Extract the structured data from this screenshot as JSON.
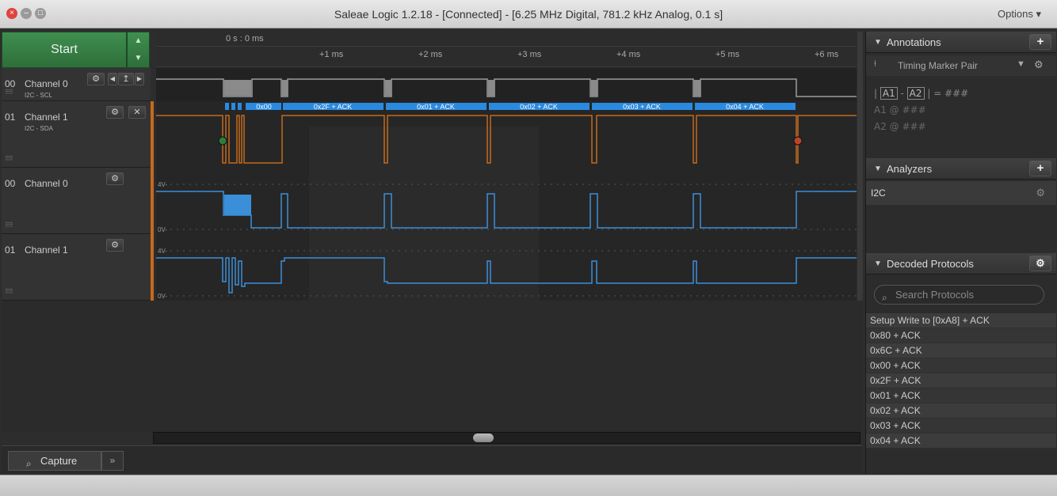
{
  "window": {
    "title": "Saleae Logic 1.2.18 - [Connected] - [6.25 MHz Digital, 781.2 kHz Analog, 0.1 s]",
    "options_label": "Options ▾"
  },
  "toolbar": {
    "start_label": "Start"
  },
  "ruler": {
    "zero_label": "0 s : 0 ms",
    "ticks": [
      "+1 ms",
      "+2 ms",
      "+3 ms",
      "+4 ms",
      "+5 ms",
      "+6 ms"
    ]
  },
  "channels": [
    {
      "num": "00",
      "name": "Channel 0",
      "sub": "I2C - SCL"
    },
    {
      "num": "01",
      "name": "Channel 1",
      "sub": "I2C - SDA"
    },
    {
      "num": "00",
      "name": "Channel 0"
    },
    {
      "num": "01",
      "name": "Channel 1"
    }
  ],
  "bus_labels": [
    "0x00",
    "0x2F + ACK",
    "0x01 + ACK",
    "0x02 + ACK",
    "0x03 + ACK",
    "0x04 + ACK"
  ],
  "analog_axis": {
    "high": "4V-",
    "low": "0V-"
  },
  "colors": {
    "digital_scl": "#9c9c9c",
    "digital_sda": "#c46a1c",
    "analog": "#3b8fd9",
    "bus": "#2a8ae0",
    "start_green": "#3f8f4f"
  },
  "bottom": {
    "capture_label": "Capture",
    "more_label": "»"
  },
  "annotations": {
    "header": "Annotations",
    "timing_marker": "Timing Marker Pair",
    "line_a": "A1",
    "line_b": "A2",
    "eq": "= ###",
    "a1_label": "A1",
    "a1_value": "@  ###",
    "a2_label": "A2",
    "a2_value": "@  ###"
  },
  "analyzers": {
    "header": "Analyzers",
    "items": [
      "I2C"
    ]
  },
  "decoded": {
    "header": "Decoded Protocols",
    "search_placeholder": "Search Protocols",
    "rows": [
      "Setup Write to [0xA8] + ACK",
      "0x80 + ACK",
      "0x6C + ACK",
      "0x00 + ACK",
      "0x2F + ACK",
      "0x01 + ACK",
      "0x02 + ACK",
      "0x03 + ACK",
      "0x04 + ACK"
    ]
  }
}
